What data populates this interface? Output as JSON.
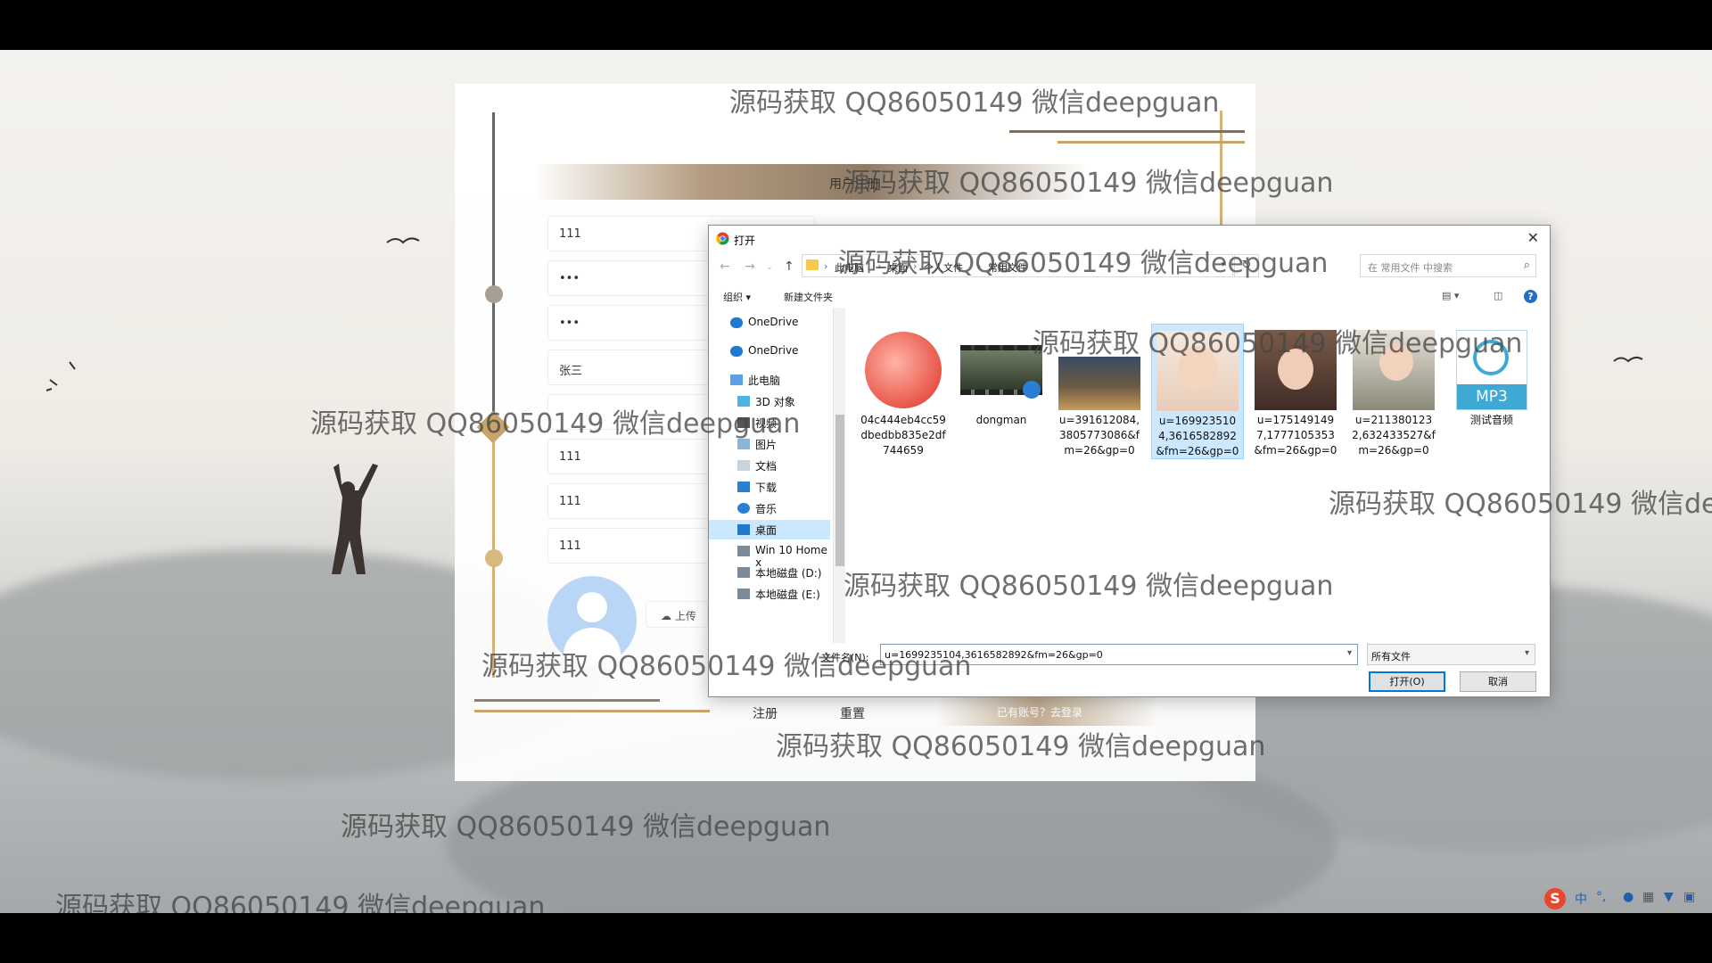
{
  "form": {
    "tab_label": "用户注册",
    "fields": [
      "111",
      "•••",
      "•••",
      "张三",
      "",
      "111",
      "111",
      "111"
    ],
    "upload_label": "上传",
    "register_label": "注册",
    "reset_label": "重置",
    "login_link": "已有账号？去登录"
  },
  "dialog": {
    "title": "打开",
    "breadcrumb": [
      "此电脑",
      "桌面",
      "个人文件",
      "常用文件"
    ],
    "search_placeholder": "在 常用文件 中搜索",
    "organize_label": "组织 ▾",
    "new_folder_label": "新建文件夹",
    "help_label": "?",
    "nav_items": [
      {
        "label": "OneDrive",
        "icon": "cloud-icon"
      },
      {
        "label": "OneDrive",
        "icon": "cloud-icon"
      },
      {
        "label": "此电脑",
        "icon": "computer-icon"
      },
      {
        "label": "3D 对象",
        "icon": "cube-icon"
      },
      {
        "label": "视频",
        "icon": "video-icon"
      },
      {
        "label": "图片",
        "icon": "picture-icon"
      },
      {
        "label": "文档",
        "icon": "document-icon"
      },
      {
        "label": "下载",
        "icon": "download-icon"
      },
      {
        "label": "音乐",
        "icon": "music-icon"
      },
      {
        "label": "桌面",
        "icon": "desktop-icon",
        "selected": true
      },
      {
        "label": "Win 10 Home x",
        "icon": "drive-icon"
      },
      {
        "label": "本地磁盘 (D:)",
        "icon": "drive-icon"
      },
      {
        "label": "本地磁盘 (E:)",
        "icon": "drive-icon"
      }
    ],
    "files": [
      {
        "name": "04c444eb4cc59dbedbb835e2df744659",
        "kind": "peach-photo"
      },
      {
        "name": "dongman",
        "kind": "video-thumb"
      },
      {
        "name": "u=391612084,3805773086&fm=26&gp=0",
        "kind": "house-photo"
      },
      {
        "name": "u=1699235104,3616582892&fm=26&gp=0",
        "kind": "baby-photo",
        "selected": true
      },
      {
        "name": "u=1751491497,1777105353&fm=26&gp=0",
        "kind": "child-photo"
      },
      {
        "name": "u=2113801232,632433527&fm=26&gp=0",
        "kind": "toddler-photo"
      },
      {
        "name": "测试音频",
        "kind": "mp3-file",
        "badge": "MP3"
      }
    ],
    "filename_label": "文件名(N):",
    "filename_value": "u=1699235104,3616582892&fm=26&gp=0",
    "filetype_value": "所有文件",
    "open_button": "打开(O)",
    "cancel_button": "取消"
  },
  "ime": {
    "lang": "中",
    "symbols": "°,"
  },
  "watermark": "源码获取 QQ86050149 微信deepguan",
  "colors": {
    "gold": "#c9a46a",
    "accent": "#0078d7",
    "select_bg": "#cce8ff"
  }
}
